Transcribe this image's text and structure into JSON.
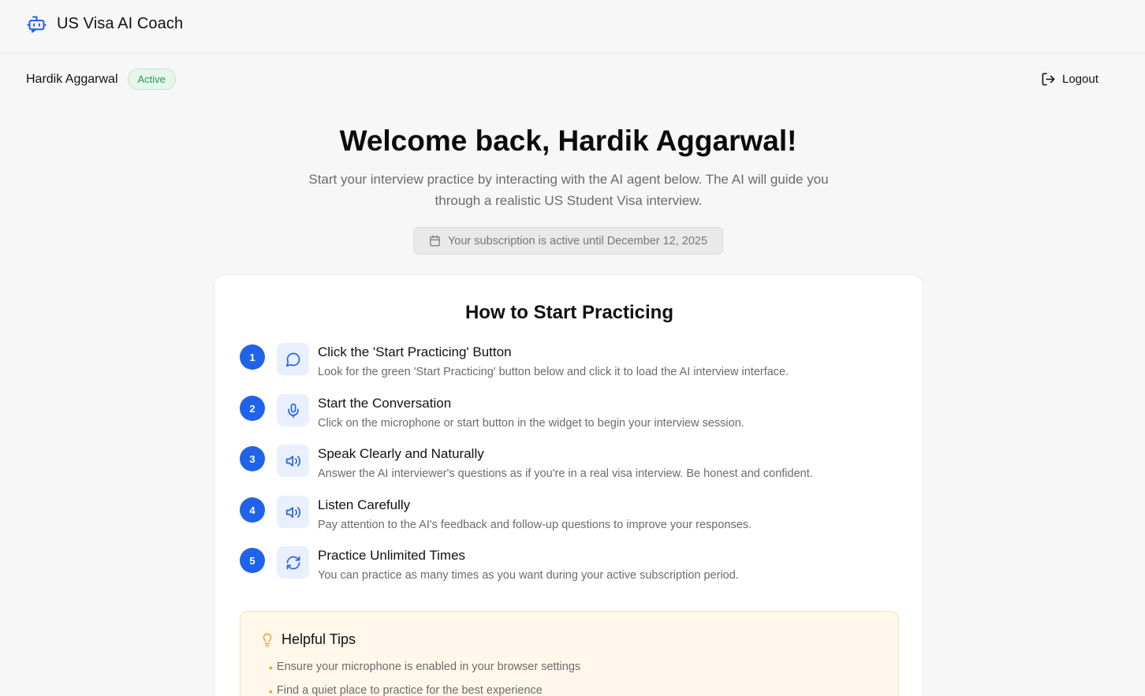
{
  "app": {
    "title": "US Visa AI Coach",
    "icon": "bot-icon"
  },
  "user": {
    "name": "Hardik Aggarwal",
    "status": "Active",
    "logout_label": "Logout"
  },
  "welcome": {
    "heading": "Welcome back, Hardik Aggarwal!",
    "line1": "Start your interview practice by interacting with the AI agent below. The AI will guide you",
    "line2": "through a realistic US Student Visa interview.",
    "subscription": "Your subscription is active until December 12, 2025"
  },
  "guide": {
    "title": "How to Start Practicing",
    "steps": [
      {
        "number": "1",
        "icon": "chat-bubble-icon",
        "title": "Click the 'Start Practicing' Button",
        "desc": "Look for the green 'Start Practicing' button below and click it to load the AI interview interface."
      },
      {
        "number": "2",
        "icon": "microphone-icon",
        "title": "Start the Conversation",
        "desc": "Click on the microphone or start button in the widget to begin your interview session."
      },
      {
        "number": "3",
        "icon": "speaker-icon",
        "title": "Speak Clearly and Naturally",
        "desc": "Answer the AI interviewer's questions as if you're in a real visa interview. Be honest and confident."
      },
      {
        "number": "4",
        "icon": "speaker-icon",
        "title": "Listen Carefully",
        "desc": "Pay attention to the AI's feedback and follow-up questions to improve your responses."
      },
      {
        "number": "5",
        "icon": "refresh-icon",
        "title": "Practice Unlimited Times",
        "desc": "You can practice as many times as you want during your active subscription period."
      }
    ]
  },
  "tips": {
    "title": "Helpful Tips",
    "items": [
      "Ensure your microphone is enabled in your browser settings",
      "Find a quiet place to practice for the best experience"
    ]
  },
  "colors": {
    "accent": "#1e63e9",
    "active_green": "#1f9d55",
    "tips_bg": "#fff8ea",
    "tips_bullet": "#f0a020"
  }
}
